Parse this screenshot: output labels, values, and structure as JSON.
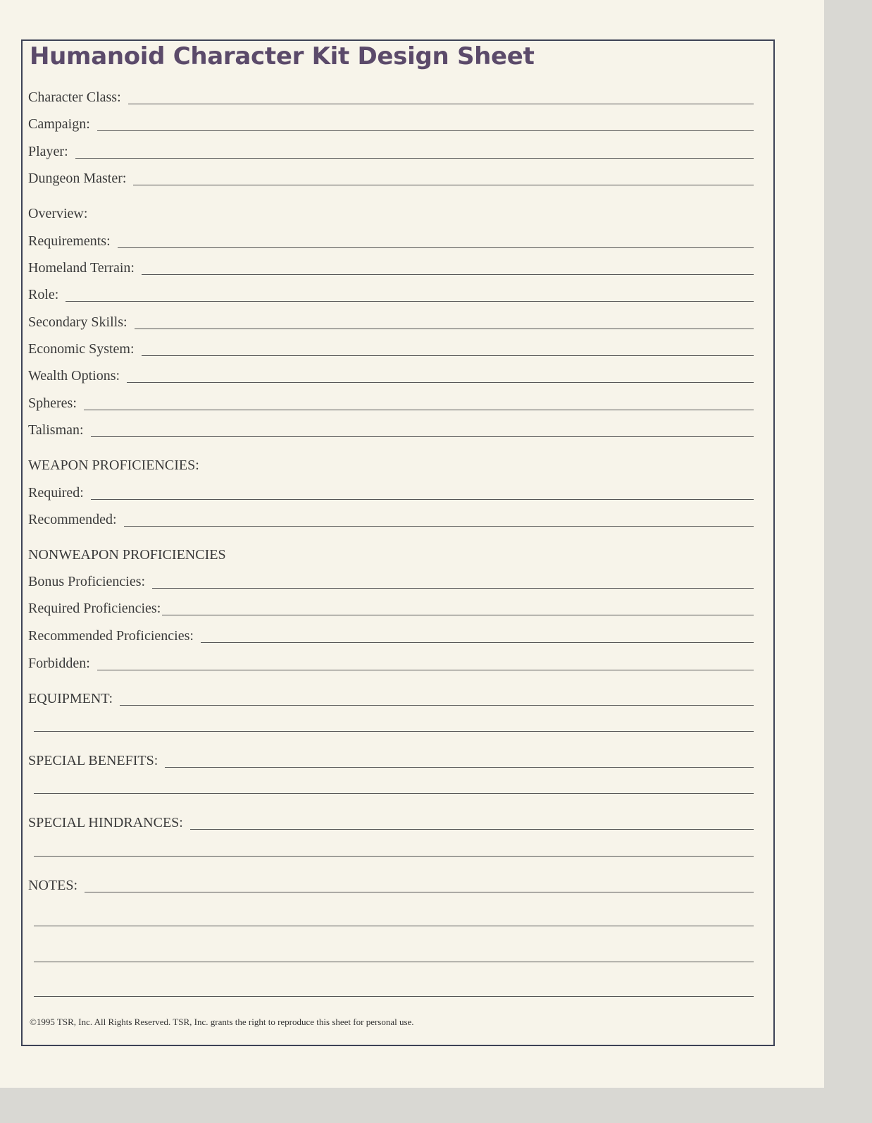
{
  "title": "Humanoid Character Kit Design Sheet",
  "fields": {
    "character_class": "Character Class:",
    "campaign": "Campaign:",
    "player": "Player:",
    "dungeon_master": "Dungeon Master:",
    "overview": "Overview:",
    "requirements": "Requirements:",
    "homeland_terrain": "Homeland Terrain:",
    "role": "Role:",
    "secondary_skills": "Secondary Skills:",
    "economic_system": "Economic System:",
    "wealth_options": "Wealth Options:",
    "spheres": "Spheres:",
    "talisman": "Talisman:",
    "weapon_proficiencies": "WEAPON PROFICIENCIES:",
    "required": "Required:",
    "recommended": "Recommended:",
    "nonweapon_proficiencies": "NONWEAPON PROFICIENCIES",
    "bonus_proficiencies": "Bonus Proficiencies:",
    "required_proficiencies": "Required Proficiencies:",
    "recommended_proficiencies": "Recommended Proficiencies:",
    "forbidden": "Forbidden:",
    "equipment": "EQUIPMENT:",
    "special_benefits": "SPECIAL BENEFITS:",
    "special_hindrances": "SPECIAL HINDRANCES:",
    "notes": "NOTES:"
  },
  "copyright": "©1995 TSR, Inc. All Rights Reserved. TSR, Inc. grants the right to reproduce this sheet for personal use."
}
